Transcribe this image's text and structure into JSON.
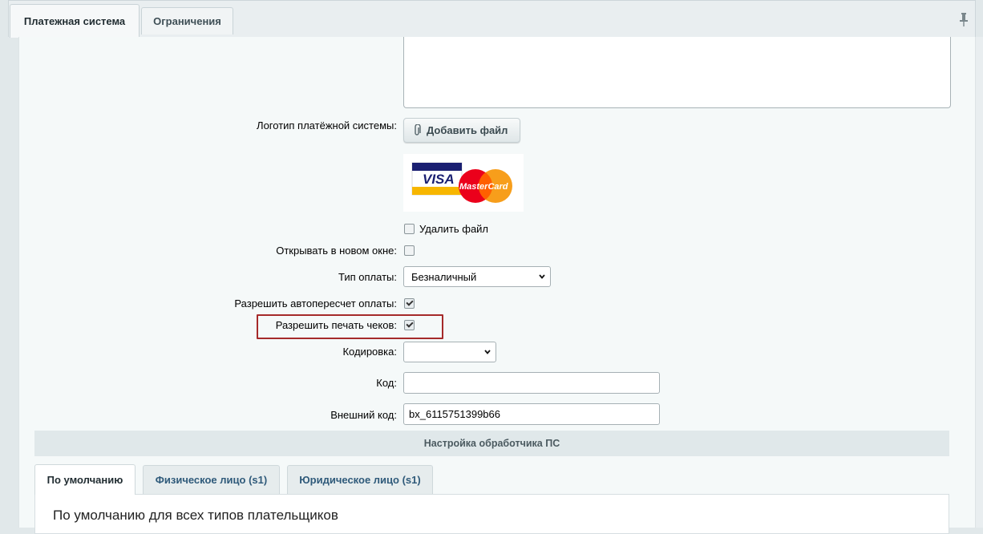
{
  "tabs": [
    {
      "label": "Платежная система",
      "active": true
    },
    {
      "label": "Ограничения",
      "active": false
    }
  ],
  "form": {
    "logo_label": "Логотип платёжной системы:",
    "add_file_button": "Добавить файл",
    "logo_image": {
      "visa_text": "VISA",
      "mastercard_text": "MasterCard"
    },
    "delete_file_label": "Удалить файл",
    "delete_file_checked": false,
    "new_window_label": "Открывать в новом окне:",
    "new_window_checked": false,
    "payment_type_label": "Тип оплаты:",
    "payment_type_value": "Безналичный",
    "auto_recalc_label": "Разрешить автопересчет оплаты:",
    "auto_recalc_checked": true,
    "print_checks_label": "Разрешить печать чеков:",
    "print_checks_checked": true,
    "encoding_label": "Кодировка:",
    "encoding_value": "",
    "code_label": "Код:",
    "code_value": "",
    "external_code_label": "Внешний код:",
    "external_code_value": "bx_6115751399b66"
  },
  "handler_section": {
    "title": "Настройка обработчика ПС",
    "tabs": [
      {
        "label": "По умолчанию",
        "active": true
      },
      {
        "label": "Физическое лицо (s1)",
        "active": false
      },
      {
        "label": "Юридическое лицо (s1)",
        "active": false
      }
    ],
    "content_title": "По умолчанию для всех типов плательщиков"
  },
  "colors": {
    "highlight_border": "#a52a2a",
    "link_tab": "#2f5a7a"
  }
}
